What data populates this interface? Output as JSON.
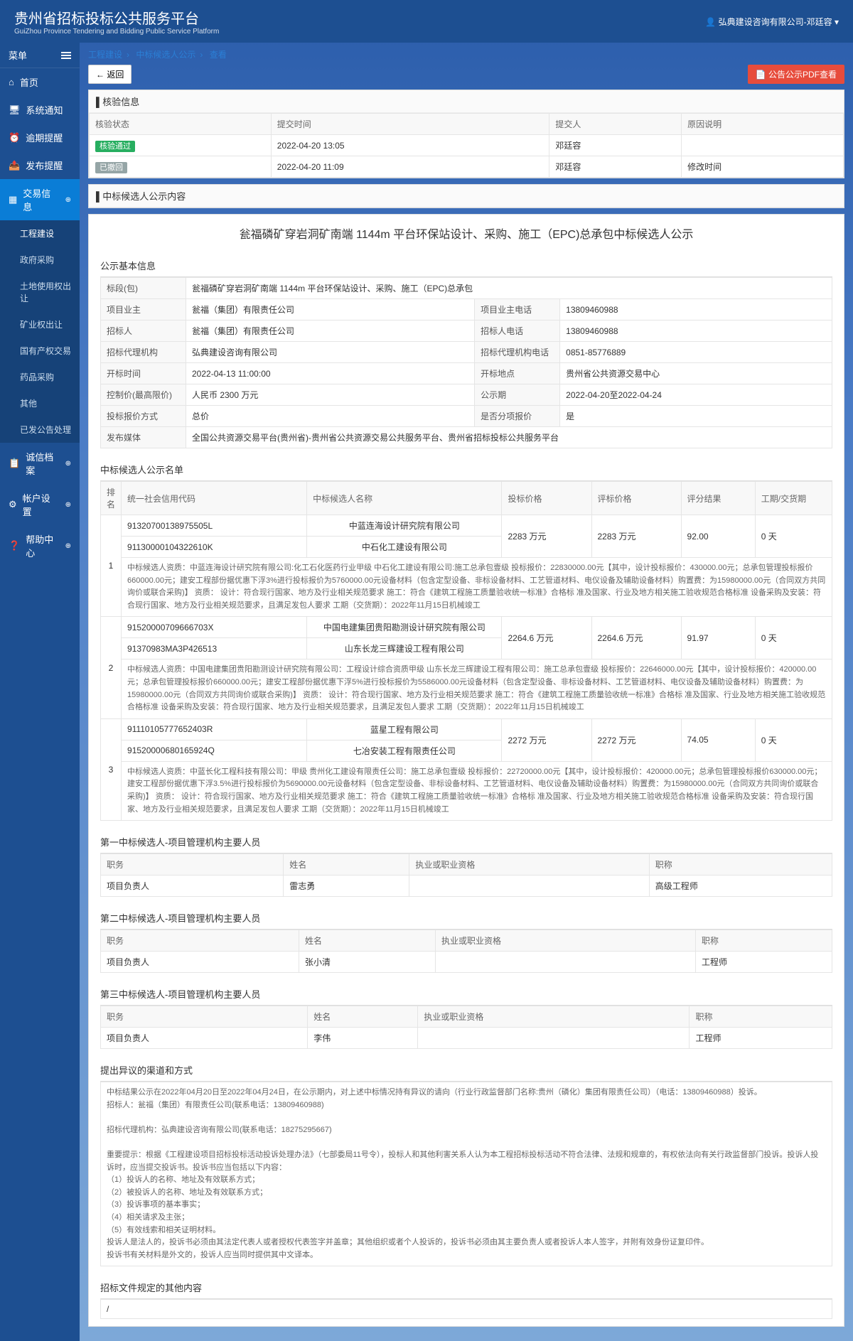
{
  "header": {
    "title": "贵州省招标投标公共服务平台",
    "subtitle": "GuiZhou Province Tendering and Bidding Public Service Platform",
    "user": "弘典建设咨询有限公司-邓廷容"
  },
  "sidebar": {
    "menu_label": "菜单",
    "items": [
      {
        "label": "首页"
      },
      {
        "label": "系统通知"
      },
      {
        "label": "逾期提醒"
      },
      {
        "label": "发布提醒"
      },
      {
        "label": "交易信息",
        "active": true,
        "children": [
          {
            "label": "工程建设",
            "sel": true
          },
          {
            "label": "政府采购"
          },
          {
            "label": "土地使用权出让"
          },
          {
            "label": "矿业权出让"
          },
          {
            "label": "国有产权交易"
          },
          {
            "label": "药品采购"
          },
          {
            "label": "其他"
          },
          {
            "label": "已发公告处理"
          }
        ]
      },
      {
        "label": "诚信档案"
      },
      {
        "label": "帐户设置"
      },
      {
        "label": "帮助中心"
      }
    ]
  },
  "breadcrumb": [
    "工程建设",
    "中标候选人公示",
    "查看"
  ],
  "buttons": {
    "back": "← 返回",
    "pdf": "公告公示PDF查看"
  },
  "verify": {
    "title": "核验信息",
    "headers": [
      "核验状态",
      "提交时间",
      "提交人",
      "原因说明"
    ],
    "rows": [
      {
        "status": "核验通过",
        "status_class": "tag-green",
        "time": "2022-04-20 13:05",
        "by": "邓廷容",
        "reason": ""
      },
      {
        "status": "已撤回",
        "status_class": "tag-gray",
        "time": "2022-04-20 11:09",
        "by": "邓廷容",
        "reason": "修改时间"
      }
    ]
  },
  "content_title": "中标候选人公示内容",
  "announce_title": "瓮福磷矿穿岩洞矿南端 1144m 平台环保站设计、采购、施工（EPC)总承包中标候选人公示",
  "basic": {
    "title": "公示基本信息",
    "rows": [
      [
        {
          "l": "标段(包)",
          "v": "瓮福磷矿穿岩洞矿南端 1144m 平台环保站设计、采购、施工（EPC)总承包",
          "span": 3
        }
      ],
      [
        {
          "l": "项目业主",
          "v": "瓮福（集团）有限责任公司"
        },
        {
          "l": "项目业主电话",
          "v": "13809460988"
        }
      ],
      [
        {
          "l": "招标人",
          "v": "瓮福（集团）有限责任公司"
        },
        {
          "l": "招标人电话",
          "v": "13809460988"
        }
      ],
      [
        {
          "l": "招标代理机构",
          "v": "弘典建设咨询有限公司"
        },
        {
          "l": "招标代理机构电话",
          "v": "0851-85776889"
        }
      ],
      [
        {
          "l": "开标时间",
          "v": "2022-04-13 11:00:00"
        },
        {
          "l": "开标地点",
          "v": "贵州省公共资源交易中心"
        }
      ],
      [
        {
          "l": "控制价(最高限价)",
          "v": "人民币 2300 万元"
        },
        {
          "l": "公示期",
          "v": "2022-04-20至2022-04-24"
        }
      ],
      [
        {
          "l": "投标报价方式",
          "v": "总价"
        },
        {
          "l": "是否分项报价",
          "v": "是"
        }
      ],
      [
        {
          "l": "发布媒体",
          "v": "全国公共资源交易平台(贵州省)-贵州省公共资源交易公共服务平台、贵州省招标投标公共服务平台",
          "span": 3
        }
      ]
    ]
  },
  "candidates": {
    "title": "中标候选人公示名单",
    "headers": [
      "排名",
      "统一社会信用代码",
      "中标候选人名称",
      "投标价格",
      "评标价格",
      "评分结果",
      "工期/交货期"
    ],
    "groups": [
      {
        "rank": "1",
        "rows": [
          {
            "code": "91320700138975505L",
            "name": "中蓝连海设计研究院有限公司"
          },
          {
            "code": "91130000104322610K",
            "name": "中石化工建设有限公司"
          }
        ],
        "bid": "2283 万元",
        "eval": "2283 万元",
        "score": "92.00",
        "period": "0 天",
        "desc": "中标候选人资质：中蓝连海设计研究院有限公司:化工石化医药行业甲级 中石化工建设有限公司:施工总承包壹级 投标报价：22830000.00元【其中，设计投标报价：430000.00元；总承包管理投标报价660000.00元；建安工程部份据优惠下浮3%进行投标报价为5760000.00元设备材料（包含定型设备、非标设备材料、工艺管道材料、电仪设备及辅助设备材料）购置费：为15980000.00元（合同双方共同询价或联合采购)】 资质： 设计：符合现行国家、地方及行业相关规范要求 施工：符合《建筑工程施工质量验收统一标准》合格标 准及国家、行业及地方相关施工验收规范合格标准 设备采购及安装：符合现行国家、地方及行业相关规范要求，且满足发包人要求 工期（交货期）：2022年11月15日机械竣工"
      },
      {
        "rank": "2",
        "rows": [
          {
            "code": "91520000709666703X",
            "name": "中国电建集团贵阳勘测设计研究院有限公司"
          },
          {
            "code": "91370983MA3P426513",
            "name": "山东长龙三辉建设工程有限公司"
          }
        ],
        "bid": "2264.6 万元",
        "eval": "2264.6 万元",
        "score": "91.97",
        "period": "0 天",
        "desc": "中标候选人资质：中国电建集团贵阳勘测设计研究院有限公司：工程设计综合资质甲级 山东长龙三辉建设工程有限公司：施工总承包壹级 投标报价：22646000.00元【其中，设计投标报价：420000.00元；总承包管理投标报价660000.00元；建安工程部份据优惠下浮5%进行投标报价为5586000.00元设备材料（包含定型设备、非标设备材料、工艺管道材料、电仪设备及辅助设备材料）购置费：为15980000.00元（合同双方共同询价或联合采购)】 资质： 设计：符合现行国家、地方及行业相关规范要求 施工：符合《建筑工程施工质量验收统一标准》合格标 准及国家、行业及地方相关施工验收规范合格标准 设备采购及安装：符合现行国家、地方及行业相关规范要求，且满足发包人要求 工期（交货期）：2022年11月15日机械竣工"
      },
      {
        "rank": "3",
        "rows": [
          {
            "code": "91110105777652403R",
            "name": "蓝星工程有限公司"
          },
          {
            "code": "91520000680165924Q",
            "name": "七冶安装工程有限责任公司"
          }
        ],
        "bid": "2272 万元",
        "eval": "2272 万元",
        "score": "74.05",
        "period": "0 天",
        "desc": "中标候选人资质：中蓝长化工程科技有限公司：甲级 贵州化工建设有限责任公司：施工总承包壹级 投标报价：22720000.00元【其中，设计投标报价：420000.00元；总承包管理投标报价630000.00元；建安工程部份据优惠下浮3.5%进行投标报价为5690000.00元设备材料（包含定型设备、非标设备材料、工艺管道材料、电仪设备及辅助设备材料）购置费：为15980000.00元（合同双方共同询价或联合采购)】 资质： 设计：符合现行国家、地方及行业相关规范要求 施工：符合《建筑工程施工质量验收统一标准》合格标 准及国家、行业及地方相关施工验收规范合格标准 设备采购及安装：符合现行国家、地方及行业相关规范要求，且满足发包人要求 工期（交货期）：2022年11月15日机械竣工"
      }
    ]
  },
  "personnel": [
    {
      "title": "第一中标候选人-项目管理机构主要人员",
      "headers": [
        "职务",
        "姓名",
        "执业或职业资格",
        "职称"
      ],
      "row": [
        "项目负责人",
        "雷志勇",
        "",
        "高级工程师"
      ]
    },
    {
      "title": "第二中标候选人-项目管理机构主要人员",
      "headers": [
        "职务",
        "姓名",
        "执业或职业资格",
        "职称"
      ],
      "row": [
        "项目负责人",
        "张小清",
        "",
        "工程师"
      ]
    },
    {
      "title": "第三中标候选人-项目管理机构主要人员",
      "headers": [
        "职务",
        "姓名",
        "执业或职业资格",
        "职称"
      ],
      "row": [
        "项目负责人",
        "李伟",
        "",
        "工程师"
      ]
    }
  ],
  "objection": {
    "title": "提出异议的渠道和方式",
    "lines": [
      "中标结果公示在2022年04月20日至2022年04月24日，在公示期内，对上述中标情况持有异议的请向（行业行政监督部门名称:贵州（磷化）集团有限责任公司）（电话：13809460988）投诉。",
      "招标人：瓮福（集团）有限责任公司(联系电话：13809460988)",
      "",
      "招标代理机构：弘典建设咨询有限公司(联系电话：18275295667)",
      "",
      "重要提示：根据《工程建设项目招标投标活动投诉处理办法》（七部委局11号令），投标人和其他利害关系人认为本工程招标投标活动不符合法律、法规和规章的，有权依法向有关行政监督部门投诉。投诉人投诉时，应当提交投诉书。投诉书应当包括以下内容：",
      "（1）投诉人的名称、地址及有效联系方式；",
      "（2）被投诉人的名称、地址及有效联系方式；",
      "（3）投诉事项的基本事实；",
      "（4）相关请求及主张；",
      "（5）有效线索和相关证明材料。",
      "投诉人是法人的，投诉书必须由其法定代表人或者授权代表签字并盖章；其他组织或者个人投诉的，投诉书必须由其主要负责人或者投诉人本人签字，并附有效身份证复印件。",
      "投诉书有关材料是外文的，投诉人应当同时提供其中文译本。"
    ]
  },
  "other": {
    "title": "招标文件规定的其他内容",
    "content": "/"
  }
}
